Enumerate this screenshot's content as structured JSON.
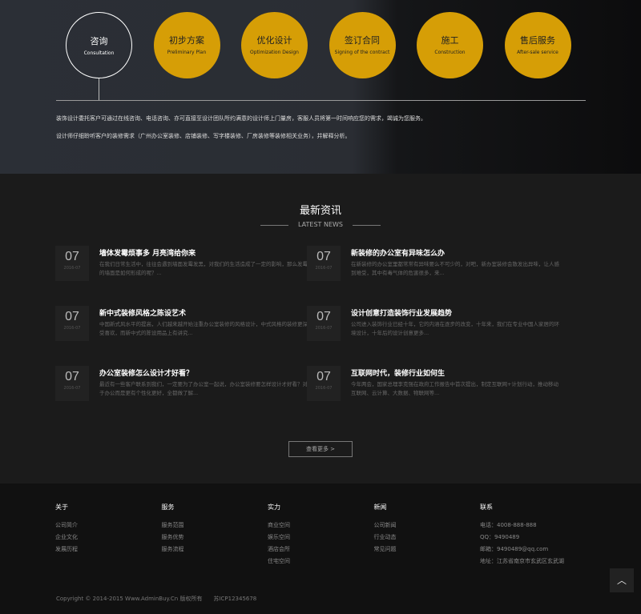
{
  "process": [
    {
      "cn": "咨询",
      "en": "Consultation",
      "active": true
    },
    {
      "cn": "初步方案",
      "en": "Preliminary Plan"
    },
    {
      "cn": "优化设计",
      "en": "Optimization Design"
    },
    {
      "cn": "签订合同",
      "en": "Signing of the contract"
    },
    {
      "cn": "施工",
      "en": "Construction"
    },
    {
      "cn": "售后服务",
      "en": "After-sale service"
    }
  ],
  "intro": [
    "装饰设计委托客户可通过在线咨询、电话咨询、亦可直接至设计团队所约满意的设计师上门量房，客服人员将第一时间响应您的需求，竭诚为您服务。",
    "设计师仔细聆听客户的装修需求（广州办公室装修、店铺装修、写字楼装修、厂房装修等装修相关业务），并解释分析。"
  ],
  "news_section": {
    "title": "最新资讯",
    "subtitle": "LATEST NEWS",
    "more": "查看更多 >"
  },
  "news": [
    {
      "day": "07",
      "date": "2016-07",
      "title": "墙体发霉烦事多 月亮湾给你来",
      "summary": "在我们日常生活中，往往会遇到墙面发霉发黑，对我们的生活造成了一定的影响，那么发霉的墙面是如何形成的呢？..."
    },
    {
      "day": "07",
      "date": "2016-07",
      "title": "新装修的办公室有异味怎么办",
      "summary": "在新装修的办公室里都常常有异味要么不可少的，对吧，新办室装修会散发出异味，让人感到难受，其中有毒气体的危害很多，来..."
    },
    {
      "day": "07",
      "date": "2016-07",
      "title": "新中式装修风格之陈设艺术",
      "summary": "中国新式风水平的提高，人们越来越开始注重办公室装修的风格设计，中式风格的装修更深受喜欢，而新中式的陈设用品上有讲究..."
    },
    {
      "day": "07",
      "date": "2016-07",
      "title": "设计创意打造装饰行业发展趋势",
      "summary": "公司进入装饰行业已经十年，它的内涵在逐步的改变，十年来，我们在专业中国人家居的环境设计，十年后的设计创意更多..."
    },
    {
      "day": "07",
      "date": "2016-07",
      "title": "办公室装修怎么设计才好看？",
      "summary": "最近有一些客户联系到我们，一定要为了办公室一起说，办公室装修要怎样设计才好看？对于办公而是更有个性化更好，全都做了解..."
    },
    {
      "day": "07",
      "date": "2016-07",
      "title": "互联网时代，装修行业如何生",
      "summary": "今年两会，国家总理李克强在政府工作报告中首次提出，制定互联网+计划行动，推动移动互联网、云计算、大数据、物联网等..."
    }
  ],
  "footer": {
    "cols": [
      {
        "title": "关于",
        "items": [
          "公司简介",
          "企业文化",
          "发展历程"
        ]
      },
      {
        "title": "服务",
        "items": [
          "服务范围",
          "服务优势",
          "服务流程"
        ]
      },
      {
        "title": "实力",
        "items": [
          "商业空间",
          "娱乐空间",
          "酒店会所",
          "住宅空间"
        ]
      },
      {
        "title": "新闻",
        "items": [
          "公司新闻",
          "行业动态",
          "常见问题"
        ]
      },
      {
        "title": "联系",
        "items": [
          "电话：4008-888-888",
          "QQ：9490489",
          "邮箱：9490489@qq.com",
          "地址：江苏省南京市玄武区玄武湖"
        ]
      }
    ],
    "copyright": "Copyright © 2014-2015 Www.AdminBuy.Cn 版权所有　　苏ICP12345678",
    "top_icon": "chevron-up-icon"
  },
  "colors": {
    "accent": "#d69e06"
  }
}
